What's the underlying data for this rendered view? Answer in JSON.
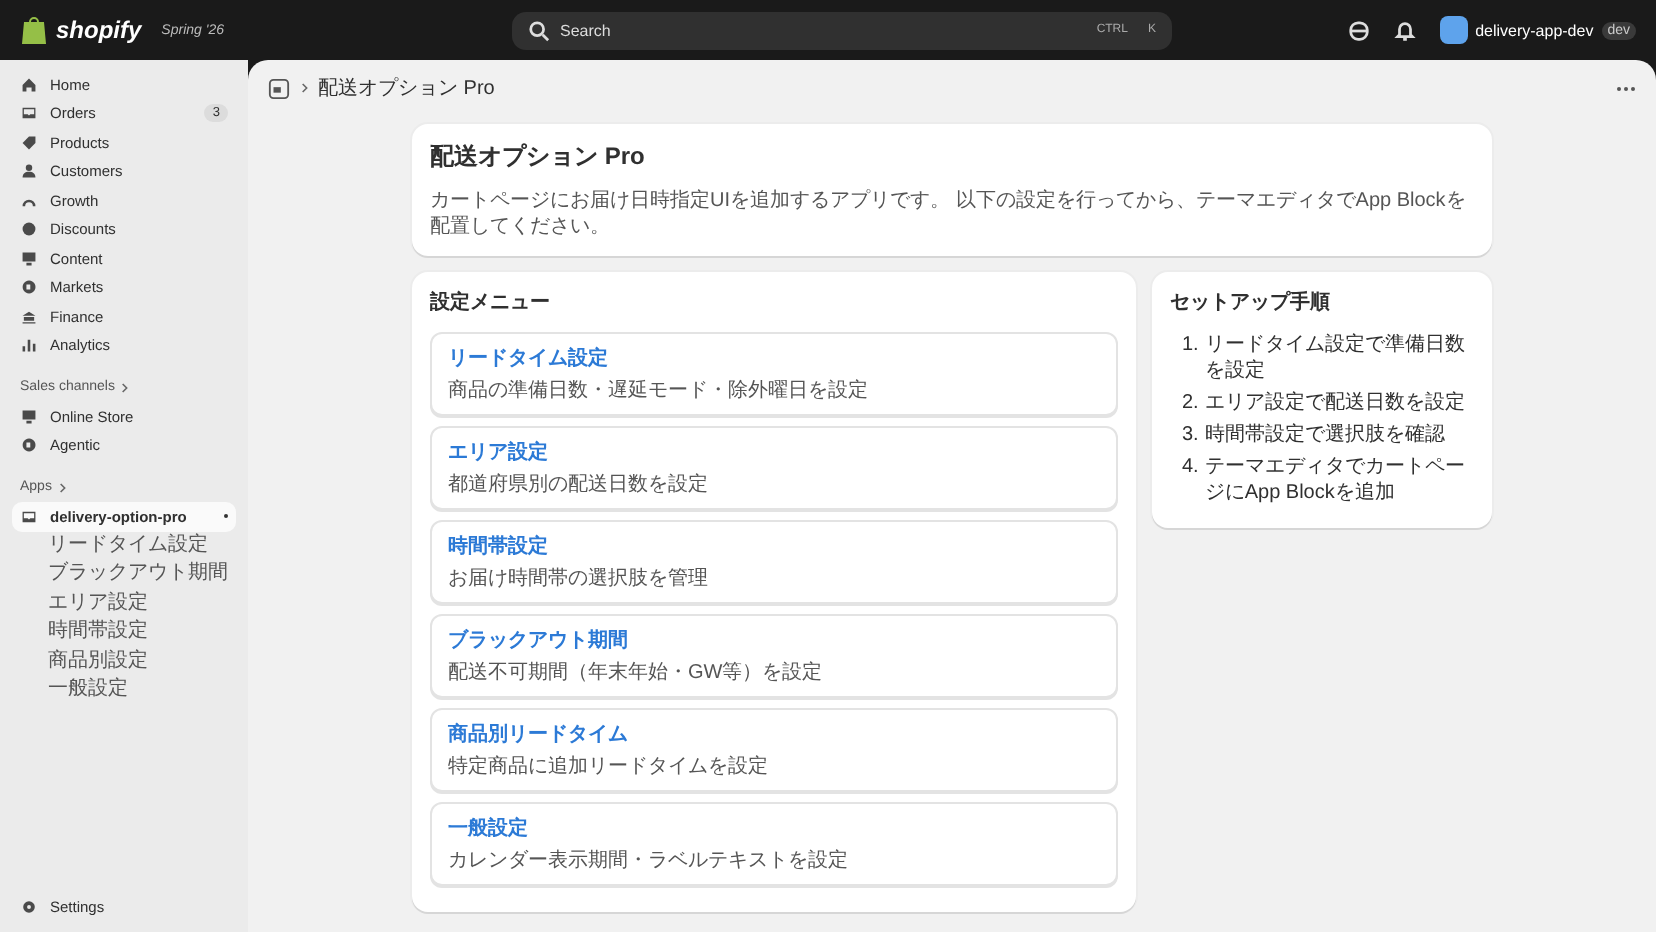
{
  "topbar": {
    "brand": "shopify",
    "version": "Spring '26",
    "search": {
      "placeholder": "Search",
      "shortcut": [
        "CTRL",
        "K"
      ]
    },
    "store": {
      "name": "delivery-app-dev",
      "badge": "dev"
    }
  },
  "sidebar": {
    "items": [
      {
        "label": "Home",
        "selected": false
      },
      {
        "label": "Orders",
        "badge": "3",
        "selected": false
      },
      {
        "label": "Products",
        "selected": false
      },
      {
        "label": "Customers",
        "selected": false
      },
      {
        "label": "Growth",
        "selected": false
      },
      {
        "label": "Discounts",
        "selected": false
      },
      {
        "label": "Content",
        "selected": false
      },
      {
        "label": "Markets",
        "selected": false
      },
      {
        "label": "Finance",
        "selected": false
      },
      {
        "label": "Analytics",
        "selected": false
      }
    ],
    "sales_channels": {
      "heading": "Sales channels",
      "items": [
        {
          "label": "Online Store",
          "selected": false
        },
        {
          "label": "Agentic",
          "selected": false
        }
      ]
    },
    "apps": {
      "heading": "Apps",
      "app": {
        "label": "delivery-option-pro",
        "selected": true,
        "children": [
          {
            "label": "リードタイム設定"
          },
          {
            "label": "ブラックアウト期間"
          },
          {
            "label": "エリア設定"
          },
          {
            "label": "時間帯設定"
          },
          {
            "label": "商品別設定"
          },
          {
            "label": "一般設定"
          }
        ]
      }
    },
    "settings": "Settings"
  },
  "breadcrumb": {
    "title": "配送オプション Pro"
  },
  "header_card": {
    "title": "配送オプション Pro",
    "description": "カートページにお届け日時指定UIを追加するアプリです。 以下の設定を行ってから、テーマエディタでApp Blockを配置してください。"
  },
  "menu_card": {
    "title": "設定メニュー",
    "items": [
      {
        "title": "リードタイム設定",
        "description": "商品の準備日数・遅延モード・除外曜日を設定"
      },
      {
        "title": "エリア設定",
        "description": "都道府県別の配送日数を設定"
      },
      {
        "title": "時間帯設定",
        "description": "お届け時間帯の選択肢を管理"
      },
      {
        "title": "ブラックアウト期間",
        "description": "配送不可期間（年末年始・GW等）を設定"
      },
      {
        "title": "商品別リードタイム",
        "description": "特定商品に追加リードタイムを設定"
      },
      {
        "title": "一般設定",
        "description": "カレンダー表示期間・ラベルテキストを設定"
      }
    ]
  },
  "setup_card": {
    "title": "セットアップ手順",
    "steps": [
      {
        "number": "1.",
        "text": "リードタイム設定で準備日数を設定"
      },
      {
        "number": "2.",
        "text": "エリア設定で配送日数を設定"
      },
      {
        "number": "3.",
        "text": "時間帯設定で選択肢を確認"
      },
      {
        "number": "4.",
        "text": "テーマエディタでカートページにApp Blockを追加"
      }
    ]
  }
}
